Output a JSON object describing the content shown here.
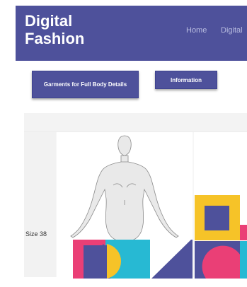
{
  "brand": {
    "line1": "Digital",
    "line2": "Fashion"
  },
  "nav": {
    "items": [
      "Home",
      "Digital"
    ]
  },
  "buttons": {
    "garments": "Garments for Full Body Details",
    "information": "Information"
  },
  "table": {
    "row_label": "Size 38"
  },
  "colors": {
    "brand": "#4e519b",
    "yellow": "#f6c328",
    "pink": "#ea3f76",
    "cyan": "#27b9d3"
  },
  "icons": [
    "mannequin-figure",
    "geometric-pattern"
  ]
}
